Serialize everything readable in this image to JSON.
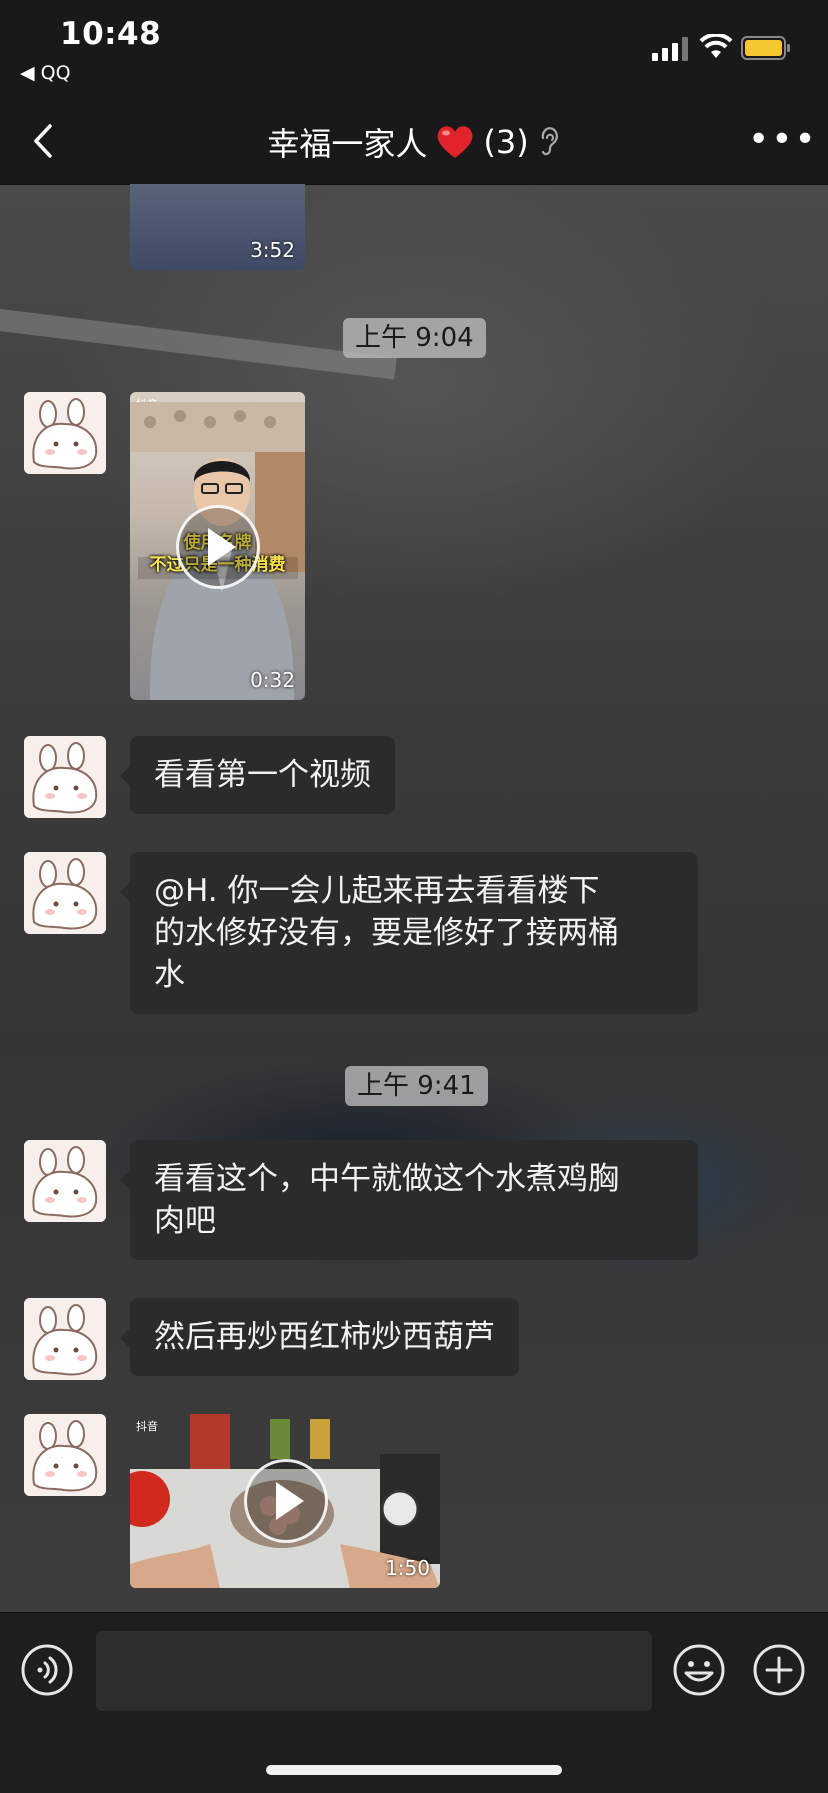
{
  "status_bar": {
    "time": "10:48",
    "back_app": "◀ QQ",
    "battery_color": "#f5c833"
  },
  "nav": {
    "title": "幸福一家人",
    "count": "(3)",
    "more_glyph": "•••"
  },
  "messages": [
    {
      "type": "video",
      "duration": "3:52",
      "partial": true
    },
    {
      "type": "timestamp",
      "text": "上午 9:04"
    },
    {
      "type": "video",
      "duration": "0:32",
      "caption_line1": "使用名牌",
      "caption_line2": "不过只是一种消费",
      "badge": "抖音"
    },
    {
      "type": "text",
      "text": "看看第一个视频"
    },
    {
      "type": "text",
      "text_lines": [
        "@H.  你一会儿起来再去看看楼下",
        "的水修好没有，要是修好了接两桶",
        "水"
      ]
    },
    {
      "type": "timestamp",
      "text": "上午 9:41"
    },
    {
      "type": "text",
      "text_lines": [
        "看看这个，中午就做这个水煮鸡胸",
        "肉吧"
      ]
    },
    {
      "type": "text",
      "text": "然后再炒西红柿炒西葫芦"
    },
    {
      "type": "video",
      "duration": "1:50",
      "badge": "抖音"
    }
  ],
  "input": {
    "placeholder": ""
  }
}
